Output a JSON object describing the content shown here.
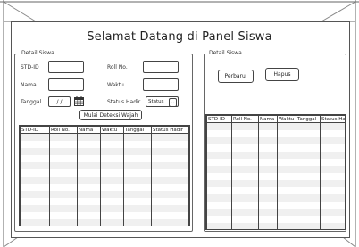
{
  "window": {
    "title": "Selamat Datang di Panel Siswa"
  },
  "left_panel": {
    "legend": "Detail Siswa",
    "fields": {
      "std_id_label": "STD-ID",
      "nama_label": "Nama",
      "tanggal_label": "Tanggal",
      "date_value": "/  /",
      "roll_label": "Roll No.",
      "waktu_label": "Waktu",
      "status_label": "Status Hadir",
      "status_value": "Status"
    },
    "detect_button": "Mulai Deteksi Wajah",
    "table": {
      "columns": [
        "STD-ID",
        "Roll No.",
        "Nama",
        "Waktu",
        "Tanggal",
        "Status Hadir"
      ]
    }
  },
  "right_panel": {
    "legend": "Detail Siswa",
    "refresh_button": "Perbarui",
    "delete_button": "Hapus",
    "table": {
      "columns": [
        "STD-ID",
        "Roll No.",
        "Nama",
        "Waktu",
        "Tanggal",
        "Status Hadir"
      ]
    }
  }
}
